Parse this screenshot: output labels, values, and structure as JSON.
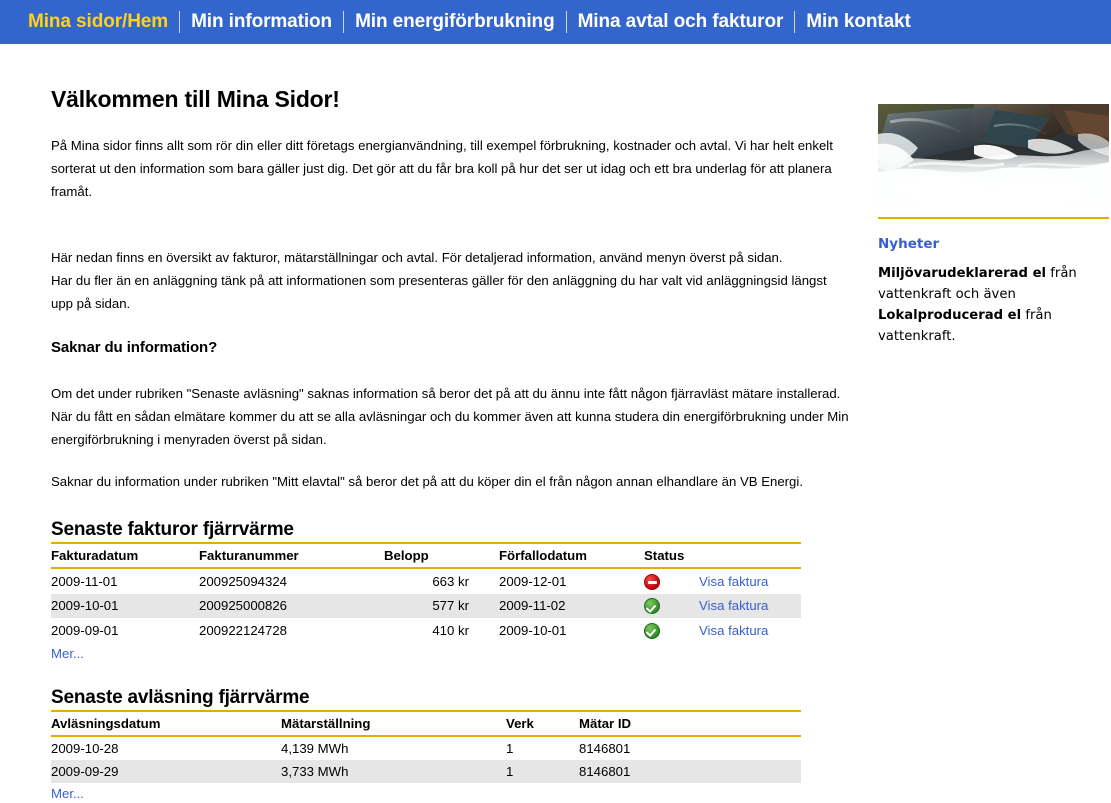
{
  "nav": {
    "items": [
      {
        "label": "Mina sidor/Hem",
        "active": true
      },
      {
        "label": "Min information",
        "active": false
      },
      {
        "label": "Min energiförbrukning",
        "active": false
      },
      {
        "label": "Mina avtal och fakturor",
        "active": false
      },
      {
        "label": "Min kontakt",
        "active": false
      }
    ]
  },
  "main": {
    "title": "Välkommen till Mina Sidor!",
    "intro_paragraph": "På Mina sidor finns allt som rör din eller ditt företags energianvändning, till exempel förbrukning, kostnader och avtal. Vi har helt enkelt sorterat ut den information som bara gäller just dig. Det gör att du får bra koll på hur det ser ut idag och ett bra underlag för att planera framåt.",
    "overview_line1": "Här nedan finns en översikt av fakturor, mätarställningar och avtal. För detaljerad information, använd menyn överst på sidan.",
    "overview_line2": "Har du fler än en anläggning tänk på att informationen som presenteras gäller för den anläggning du har valt vid anläggningsid längst upp på sidan.",
    "missing_info_heading": "Saknar du information?",
    "missing_info_paragraph": "Om det under rubriken \"Senaste avläsning\" saknas information så beror det på att du ännu inte fått någon fjärravläst mätare installerad. När du fått en sådan elmätare kommer du att se alla avläsningar och du kommer även att kunna studera din energiförbrukning under Min energiförbrukning i menyraden överst på sidan.",
    "elavtal_paragraph": "Saknar du information under rubriken \"Mitt elavtal\" så beror det på att du köper din el från någon annan elhandlare än VB Energi."
  },
  "invoices": {
    "heading": "Senaste fakturor fjärrvärme",
    "columns": [
      "Fakturadatum",
      "Fakturanummer",
      "Belopp",
      "Förfallodatum",
      "Status",
      ""
    ],
    "rows": [
      {
        "fakturadatum": "2009-11-01",
        "fakturanummer": "200925094324",
        "belopp": "663 kr",
        "forfallodatum": "2009-12-01",
        "status": "unpaid",
        "action_label": "Visa faktura"
      },
      {
        "fakturadatum": "2009-10-01",
        "fakturanummer": "200925000826",
        "belopp": "577 kr",
        "forfallodatum": "2009-11-02",
        "status": "paid",
        "action_label": "Visa faktura"
      },
      {
        "fakturadatum": "2009-09-01",
        "fakturanummer": "200922124728",
        "belopp": "410 kr",
        "forfallodatum": "2009-10-01",
        "status": "paid",
        "action_label": "Visa faktura"
      }
    ],
    "more_label": "Mer..."
  },
  "readings": {
    "heading": "Senaste avläsning fjärrvärme",
    "columns": [
      "Avläsningsdatum",
      "Mätarställning",
      "Verk",
      "Mätar ID"
    ],
    "rows": [
      {
        "avlasningsdatum": "2009-10-28",
        "matarstallning": "4,139 MWh",
        "verk": "1",
        "matar_id": "8146801"
      },
      {
        "avlasningsdatum": "2009-09-29",
        "matarstallning": "3,733 MWh",
        "verk": "1",
        "matar_id": "8146801"
      }
    ],
    "more_label": "Mer..."
  },
  "sidebar": {
    "image_alt": "waterfall-rapids-photo",
    "news_title": "Nyheter",
    "news_part1": "Miljövarudeklarerad el",
    "news_part2": " från vattenkraft och även ",
    "news_part3": "Lokalproducerad el",
    "news_part4": " från vattenkraft."
  },
  "colors": {
    "nav_background": "#3366cc",
    "nav_active_text": "#ffd11a",
    "rule_gold": "#e8a900",
    "link_blue": "#3a5fcd",
    "alt_row": "#e6e6e6",
    "status_paid": "#2e8b26",
    "status_unpaid": "#c00000"
  }
}
